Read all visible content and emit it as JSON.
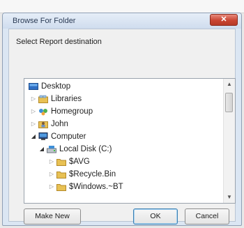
{
  "dialog": {
    "title": "Browse For Folder",
    "close_label": "✕",
    "prompt": "Select Report destination"
  },
  "tree": {
    "items": [
      {
        "label": "Desktop",
        "icon": "desktop-icon",
        "expander": "none",
        "depth": 0
      },
      {
        "label": "Libraries",
        "icon": "libraries-icon",
        "expander": "collapsed",
        "depth": 1
      },
      {
        "label": "Homegroup",
        "icon": "homegroup-icon",
        "expander": "collapsed",
        "depth": 1
      },
      {
        "label": "John",
        "icon": "user-folder-icon",
        "expander": "collapsed",
        "depth": 1
      },
      {
        "label": "Computer",
        "icon": "computer-icon",
        "expander": "expanded",
        "depth": 1
      },
      {
        "label": "Local Disk (C:)",
        "icon": "drive-icon",
        "expander": "expanded",
        "depth": 2
      },
      {
        "label": "$AVG",
        "icon": "folder-icon",
        "expander": "collapsed",
        "depth": 3
      },
      {
        "label": "$Recycle.Bin",
        "icon": "folder-icon",
        "expander": "collapsed",
        "depth": 3
      },
      {
        "label": "$Windows.~BT",
        "icon": "folder-icon",
        "expander": "collapsed",
        "depth": 3
      }
    ]
  },
  "buttons": {
    "make_new_folder": "Make New Folder",
    "ok": "OK",
    "cancel": "Cancel"
  },
  "colors": {
    "close_button": "#c94532",
    "window_frame": "#dbe6f3",
    "folder": "#e8c154"
  }
}
